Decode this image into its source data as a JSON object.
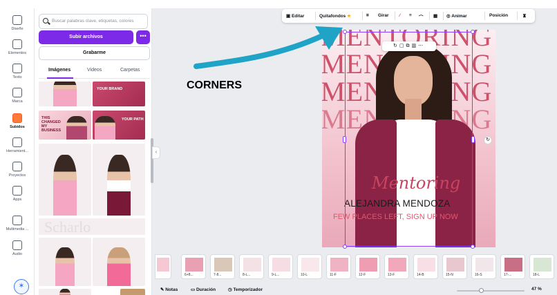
{
  "rail": [
    {
      "label": "Diseño",
      "icon": "design-icon"
    },
    {
      "label": "Elementos",
      "icon": "elements-icon"
    },
    {
      "label": "Texto",
      "icon": "text-icon"
    },
    {
      "label": "Marca",
      "icon": "brand-icon"
    },
    {
      "label": "Subidos",
      "icon": "uploads-icon"
    },
    {
      "label": "Herramient...",
      "icon": "tools-icon"
    },
    {
      "label": "Proyectos",
      "icon": "projects-icon"
    },
    {
      "label": "Apps",
      "icon": "apps-icon"
    },
    {
      "label": "Multimedia ...",
      "icon": "media-icon"
    },
    {
      "label": "Audio",
      "icon": "audio-icon"
    }
  ],
  "panel": {
    "search_placeholder": "Buscar palabras clave, etiquetas, colores",
    "upload_label": "Subir archivos",
    "more_label": "•••",
    "record_label": "Grabarme",
    "tabs": [
      "Imágenes",
      "Videos",
      "Carpetas"
    ],
    "thumb_text": {
      "brand": "YOUR BRAND",
      "changed": "THIS CHANGED MY BUSINESS",
      "path": "YOUR PATH",
      "watermark": "Scharlo"
    }
  },
  "toolbar": {
    "edit": "Editar",
    "bg_remove": "Quitafondos",
    "rotate": "Girar",
    "animate": "Animar",
    "position": "Posición"
  },
  "design": {
    "words": [
      "MENTORING",
      "MENTORING",
      "MENTORING",
      "MENTORING"
    ],
    "script": "Mentoring",
    "name": "ALEJANDRA MENDOZA",
    "places": "FEW PLACES LEFT, SIGN UP NOW"
  },
  "annotation": "CORNERS",
  "filmstrip": [
    "6+8...",
    "7-8...",
    "8-L...",
    "9-L...",
    "10-L",
    "11-F",
    "12-F",
    "13-F",
    "14-B",
    "15-N",
    "16-S",
    "17-...",
    "18-L"
  ],
  "footer": {
    "notes": "Notas",
    "duration": "Duración",
    "timer": "Temporizador",
    "zoom": "47 %",
    "zoom_level": 0.47
  },
  "colors": {
    "accent": "#7d2ae8",
    "arrow": "#1fa3c6",
    "brand_pink": "#c8445f"
  }
}
